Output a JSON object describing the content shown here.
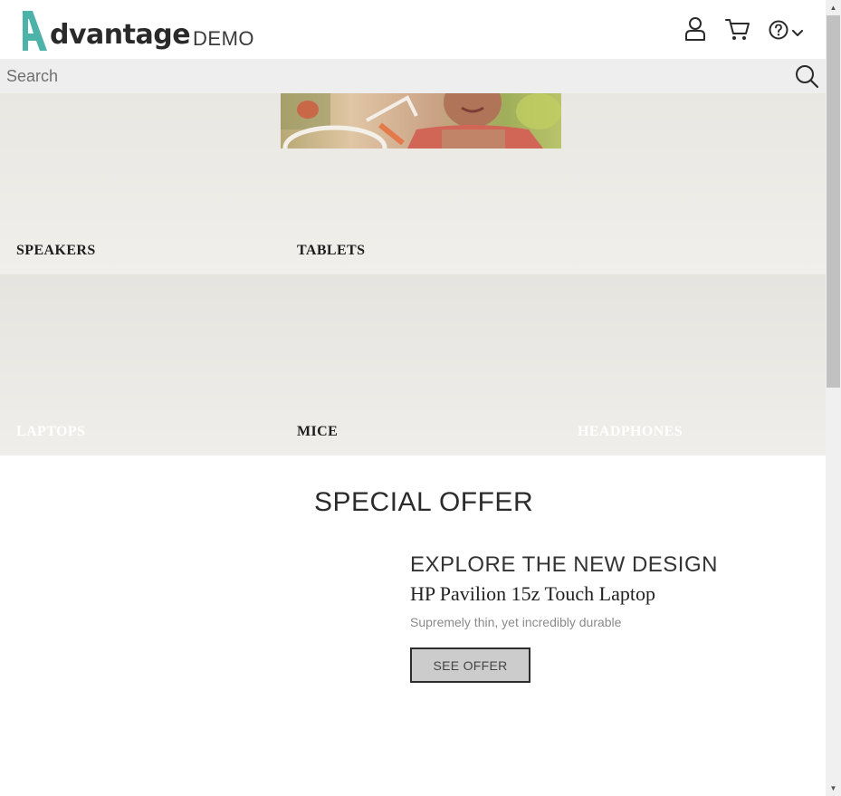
{
  "brand": {
    "word": "dvantage",
    "suffix": "DEMO",
    "accent_color": "#4db3a8"
  },
  "header_icons": [
    "user-icon",
    "cart-icon",
    "help-icon",
    "chevron-down-icon"
  ],
  "search": {
    "placeholder": "Search",
    "value": ""
  },
  "categories": [
    {
      "label": "SPEAKERS"
    },
    {
      "label": "TABLETS"
    },
    {
      "label": "LAPTOPS"
    },
    {
      "label": "MICE"
    },
    {
      "label": "HEADPHONES"
    }
  ],
  "special_offer": {
    "heading": "SPECIAL OFFER",
    "subheading": "EXPLORE THE NEW DESIGN",
    "product": "HP Pavilion 15z Touch Laptop",
    "description": "Supremely thin, yet incredibly durable",
    "button_label": "SEE OFFER"
  }
}
